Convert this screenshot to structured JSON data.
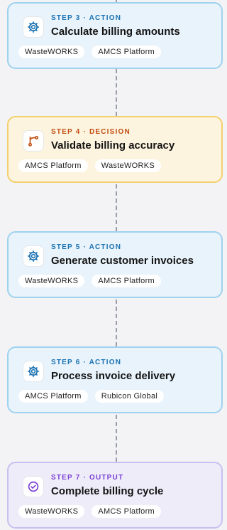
{
  "colors": {
    "action_accent": "#1a72b3",
    "decision_accent": "#c14d12",
    "output_accent": "#7a3fd4"
  },
  "steps": [
    {
      "label": "STEP 3 · ACTION",
      "title": "Calculate billing amounts",
      "kind": "action",
      "icon": "gear-icon",
      "tags": [
        "WasteWORKS",
        "AMCS Platform"
      ]
    },
    {
      "label": "STEP 4 · DECISION",
      "title": "Validate billing accuracy",
      "kind": "decision",
      "icon": "branch-icon",
      "tags": [
        "AMCS Platform",
        "WasteWORKS"
      ]
    },
    {
      "label": "STEP 5 · ACTION",
      "title": "Generate customer invoices",
      "kind": "action",
      "icon": "gear-icon",
      "tags": [
        "WasteWORKS",
        "AMCS Platform"
      ]
    },
    {
      "label": "STEP 6 · ACTION",
      "title": "Process invoice delivery",
      "kind": "action",
      "icon": "gear-icon",
      "tags": [
        "AMCS Platform",
        "Rubicon Global"
      ]
    },
    {
      "label": "STEP 7 · OUTPUT",
      "title": "Complete billing cycle",
      "kind": "output",
      "icon": "check-circle-icon",
      "tags": [
        "WasteWORKS",
        "AMCS Platform"
      ]
    }
  ]
}
